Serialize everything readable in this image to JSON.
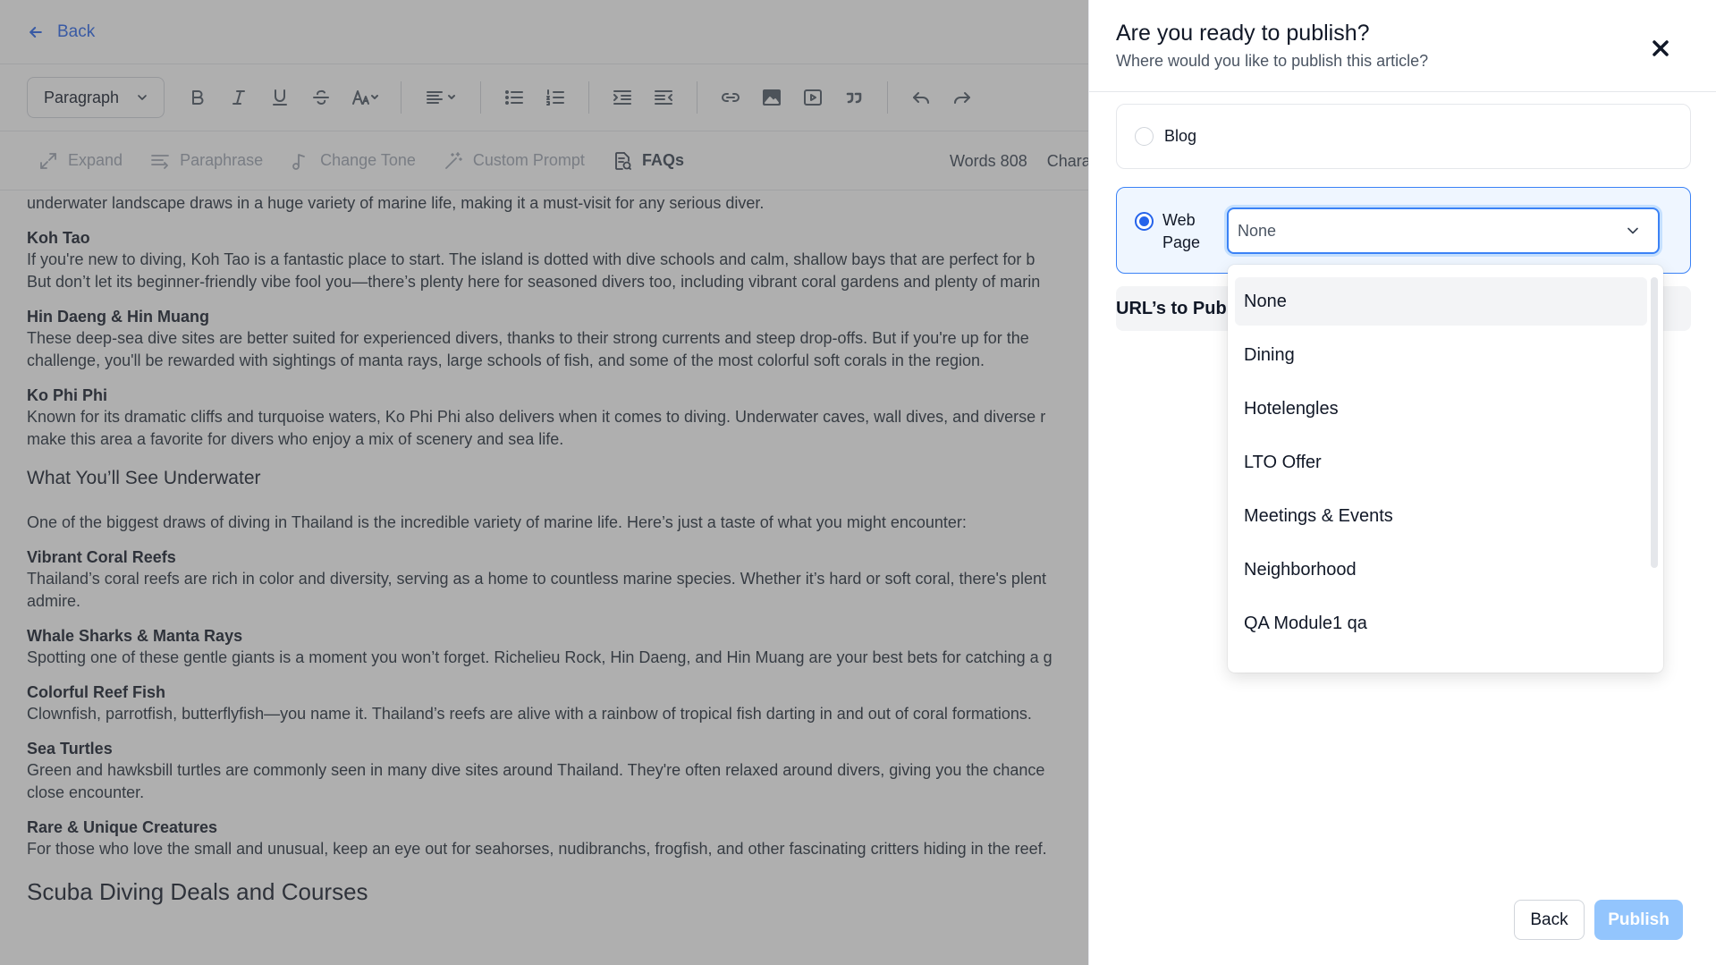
{
  "editor": {
    "back_label": "Back",
    "paragraph_select": "Paragraph",
    "ai_actions": [
      {
        "label": "Expand"
      },
      {
        "label": "Paraphrase"
      },
      {
        "label": "Change Tone"
      },
      {
        "label": "Custom Prompt"
      },
      {
        "label": "FAQs"
      }
    ],
    "words_label": "Words 808",
    "chars_label": "Chara",
    "content": {
      "lead": "underwater landscape draws in a huge variety of marine life, making it a must-visit for any serious diver.",
      "s1_title": "Koh Tao",
      "s1_l1": "If you're new to diving, Koh Tao is a fantastic place to start. The island is dotted with dive schools and calm, shallow bays that are perfect for b",
      "s1_l2": "But don’t let its beginner-friendly vibe fool you—there’s plenty here for seasoned divers too, including vibrant coral gardens and plenty of marin",
      "s2_title": "Hin Daeng & Hin Muang",
      "s2_l1": "These deep-sea dive sites are better suited for experienced divers, thanks to their strong currents and steep drop-offs. But if you're up for the",
      "s2_l2": "challenge, you'll be rewarded with sightings of manta rays, large schools of fish, and some of the most colorful soft corals in the region.",
      "s3_title": "Ko Phi Phi",
      "s3_l1": "Known for its dramatic cliffs and turquoise waters, Ko Phi Phi also delivers when it comes to diving. Underwater caves, wall dives, and diverse r",
      "s3_l2": "make this area a favorite for divers who enjoy a mix of scenery and sea life.",
      "h_underwater": "What You’ll See Underwater",
      "intro": "One of the biggest draws of diving in Thailand is the incredible variety of marine life. Here’s just a taste of what you might encounter:",
      "s4_title": "Vibrant Coral Reefs",
      "s4_l1": "Thailand’s coral reefs are rich in color and diversity, serving as a home to countless marine species. Whether it’s hard or soft coral, there's plent",
      "s4_l2": "admire.",
      "s5_title": "Whale Sharks & Manta Rays",
      "s5_l1": "Spotting one of these gentle giants is a moment you won’t forget. Richelieu Rock, Hin Daeng, and Hin Muang are your best bets for catching a g",
      "s6_title": "Colorful Reef Fish",
      "s6_l1": "Clownfish, parrotfish, butterflyfish—you name it. Thailand’s reefs are alive with a rainbow of tropical fish darting in and out of coral formations.",
      "s7_title": "Sea Turtles",
      "s7_l1": "Green and hawksbill turtles are commonly seen in many dive sites around Thailand. They're often relaxed around divers, giving you the chance",
      "s7_l2": "close encounter.",
      "s8_title": "Rare & Unique Creatures",
      "s8_l1": "For those who love the small and unusual, keep an eye out for seahorses, nudibranchs, frogfish, and other fascinating critters hiding in the reef.",
      "h_deals": "Scuba Diving Deals and Courses"
    }
  },
  "panel": {
    "title": "Are you ready to publish?",
    "subtitle": "Where would you like to publish this article?",
    "option_blog": "Blog",
    "option_web_page": "Web Page",
    "select_value": "None",
    "urls_label": "URL’s to Publ",
    "dropdown_options": [
      "None",
      "Dining",
      "Hotelengles",
      "LTO Offer",
      "Meetings & Events",
      "Neighborhood",
      "QA Module1 qa"
    ],
    "back_button": "Back",
    "publish_button": "Publish"
  },
  "colors": {
    "accent": "#2563eb",
    "publish_disabled": "#93c5fd",
    "selected_card_bg": "#eff6ff"
  }
}
